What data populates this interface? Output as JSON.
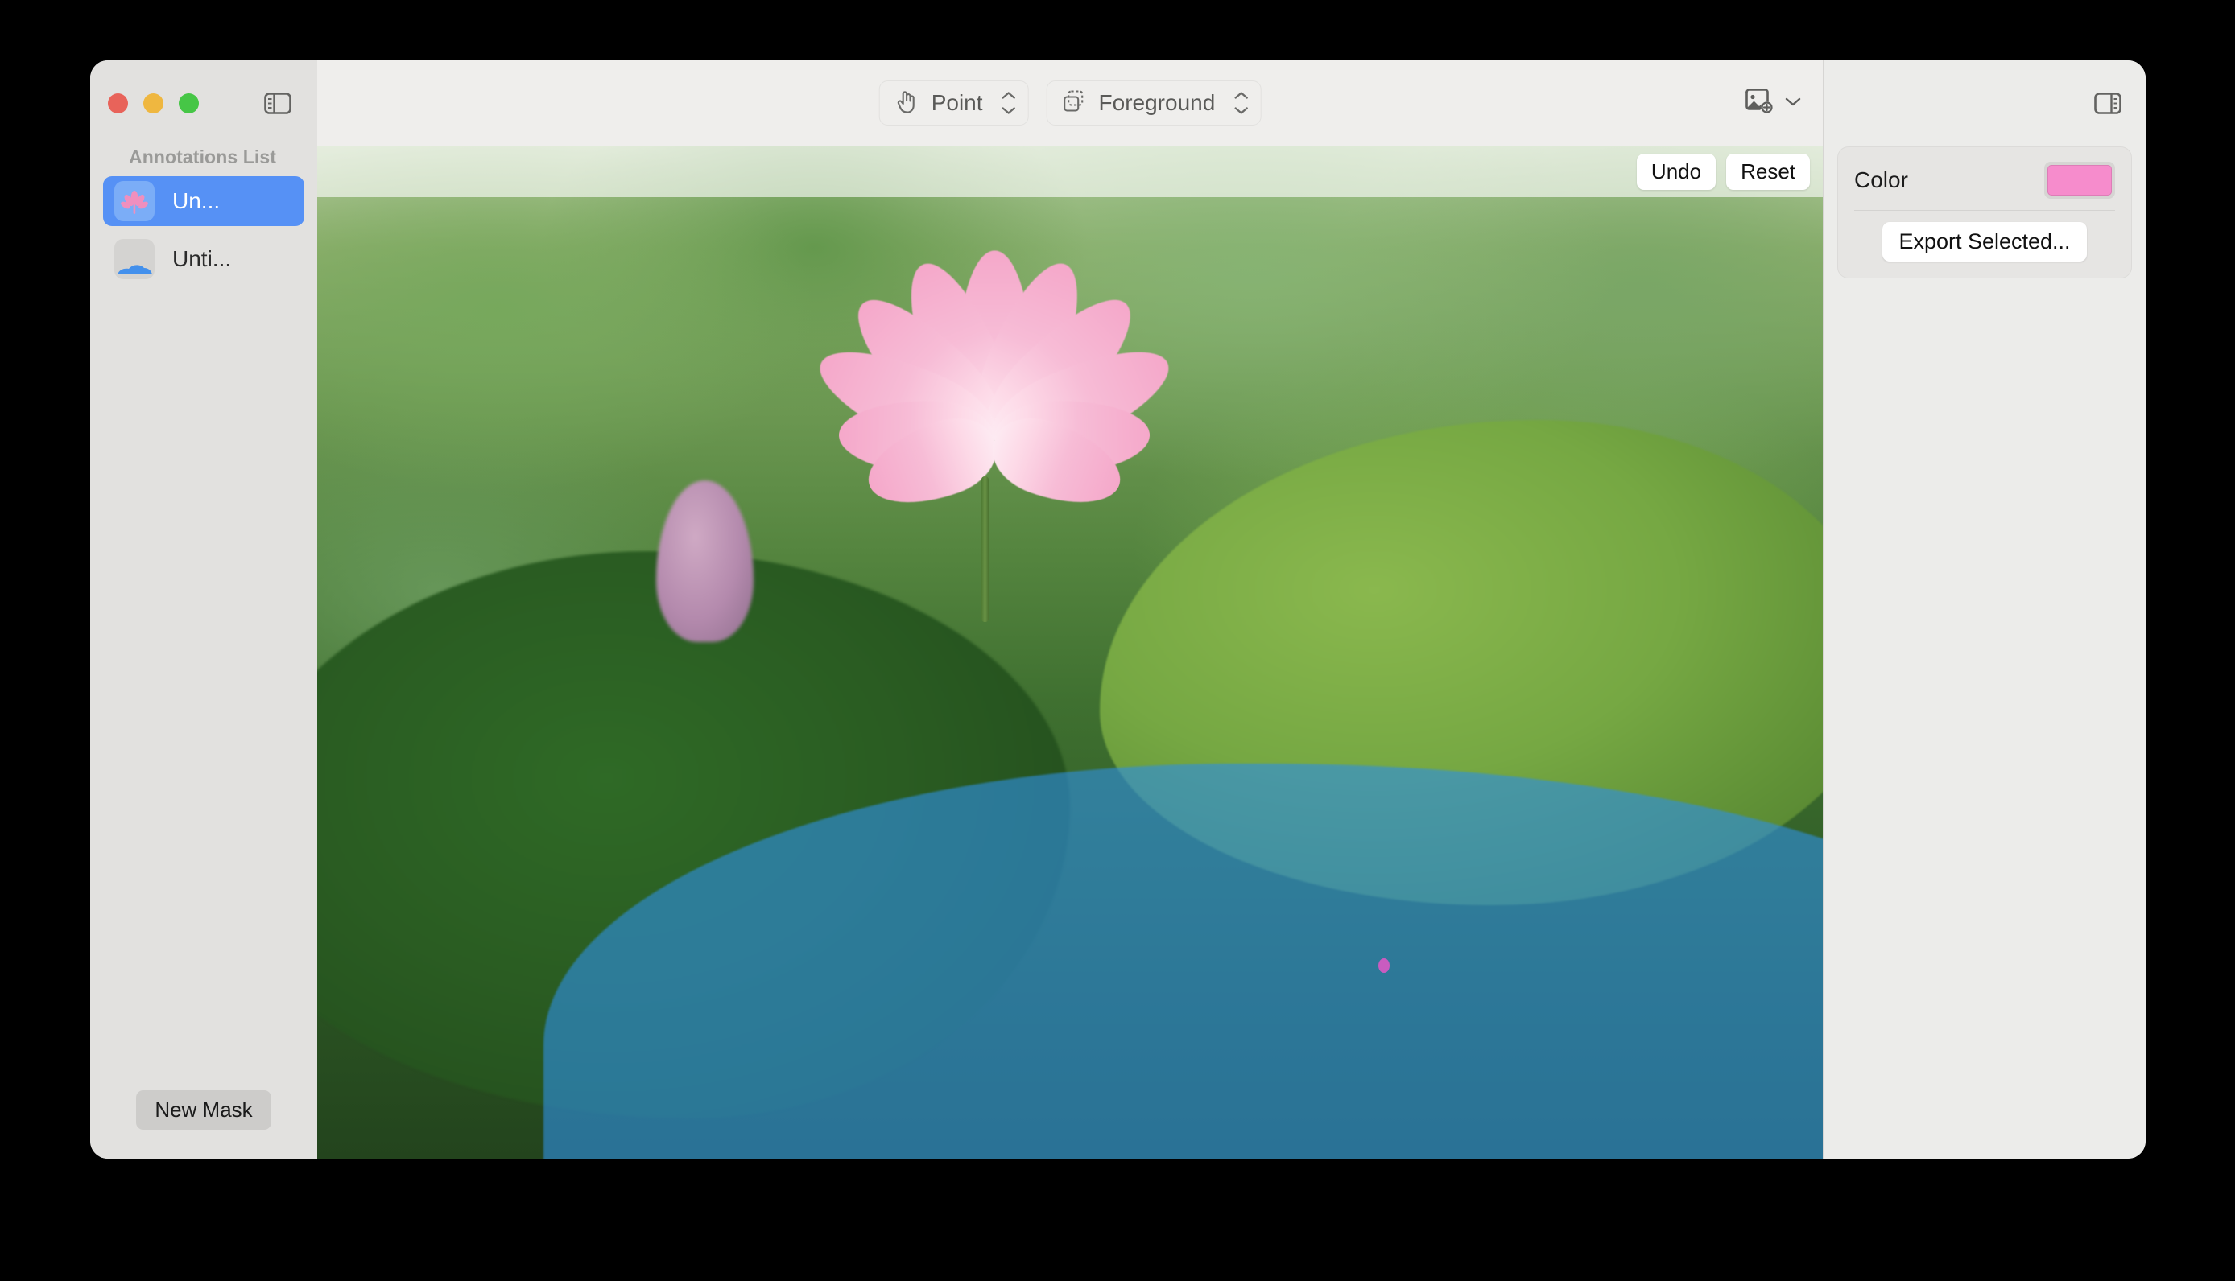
{
  "window": {
    "traffic_lights": [
      "close",
      "minimize",
      "zoom"
    ]
  },
  "sidebar": {
    "header": "Annotations List",
    "toggle_icon": "sidebar-left-icon",
    "items": [
      {
        "label": "Un...",
        "thumb_icon": "flower-mask-thumb",
        "selected": true
      },
      {
        "label": "Unti...",
        "thumb_icon": "leaf-mask-thumb",
        "selected": false
      }
    ],
    "new_mask_label": "New Mask"
  },
  "toolbar": {
    "mode_picker": {
      "label": "Point",
      "icon": "pointing-hand-icon"
    },
    "layer_picker": {
      "label": "Foreground",
      "icon": "layers-icon"
    },
    "add_image": {
      "icon": "add-photo-icon",
      "chevron": "chevron-down-icon"
    },
    "inspector_toggle_icon": "sidebar-right-icon"
  },
  "canvas": {
    "undo_label": "Undo",
    "reset_label": "Reset",
    "mask_overlay_color": "#2F8FE0",
    "point_marker_color": "#C95CC0"
  },
  "inspector": {
    "color_label": "Color",
    "color_value": "#F68CCC",
    "export_label": "Export Selected..."
  }
}
